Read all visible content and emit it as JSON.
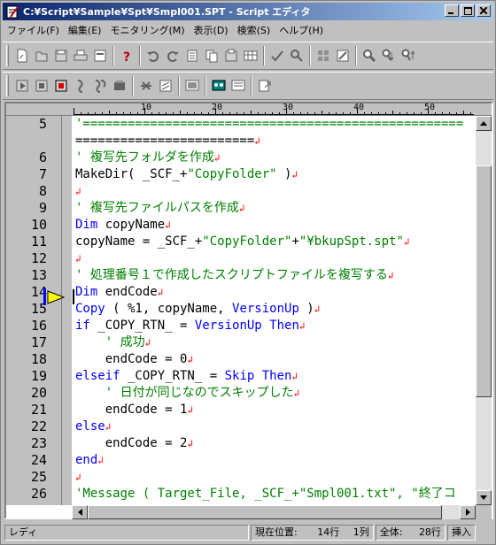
{
  "window": {
    "title": "C:¥Script¥Sample¥Spt¥Smpl001.SPT - Script エディタ"
  },
  "menu": [
    {
      "label": "ファイル(F)"
    },
    {
      "label": "編集(E)"
    },
    {
      "label": "モニタリング(M)"
    },
    {
      "label": "表示(D)"
    },
    {
      "label": "検索(S)"
    },
    {
      "label": "ヘルプ(H)"
    }
  ],
  "ruler": [
    "10",
    "20",
    "30",
    "40",
    "50"
  ],
  "editor": {
    "current_line": "14",
    "lines": [
      {
        "n": "5",
        "text": "'==================================================="
      },
      {
        "n": "",
        "text": "========================"
      },
      {
        "n": "6",
        "text": "' 複写先フォルダを作成"
      },
      {
        "n": "7",
        "text": "MakeDir( _SCF_+\"CopyFolder\" )"
      },
      {
        "n": "8",
        "text": ""
      },
      {
        "n": "9",
        "text": "' 複写先ファイルパスを作成"
      },
      {
        "n": "10",
        "text": "Dim copyName"
      },
      {
        "n": "11",
        "text": "copyName = _SCF_+\"CopyFolder\"+\"¥bkupSpt.spt\""
      },
      {
        "n": "12",
        "text": ""
      },
      {
        "n": "13",
        "text": "' 処理番号１で作成したスクリプトファイルを複写する"
      },
      {
        "n": "14",
        "text": "Dim endCode"
      },
      {
        "n": "15",
        "text": "Copy ( %1, copyName, VersionUp )"
      },
      {
        "n": "16",
        "text": "if _COPY_RTN_ = VersionUp Then"
      },
      {
        "n": "17",
        "text": "    ' 成功"
      },
      {
        "n": "18",
        "text": "    endCode = 0"
      },
      {
        "n": "19",
        "text": "elseif _COPY_RTN_ = Skip Then"
      },
      {
        "n": "20",
        "text": "    ' 日付が同じなのでスキップした"
      },
      {
        "n": "21",
        "text": "    endCode = 1"
      },
      {
        "n": "22",
        "text": "else"
      },
      {
        "n": "23",
        "text": "    endCode = 2"
      },
      {
        "n": "24",
        "text": "end"
      },
      {
        "n": "25",
        "text": ""
      },
      {
        "n": "26",
        "text": "'Message ( Target_File, _SCF_+\"Smpl001.txt\", \"終了コ"
      }
    ],
    "eol_mark": "↲"
  },
  "status": {
    "mode": "レディ",
    "position_label": "現在位置:",
    "position_line": "14行",
    "position_col": "1列",
    "total_label": "全体:",
    "total_lines": "28行",
    "insert": "挿入"
  },
  "icons": {
    "toolbar1": [
      "new-file-icon",
      "open-file-icon",
      "save-icon",
      "print-icon",
      "export-icon",
      "help-icon",
      "undo-icon",
      "redo-icon",
      "cut-icon",
      "copy-icon",
      "paste-icon",
      "table-icon",
      "check-icon",
      "search-replace-icon",
      "grid-icon",
      "edit-icon",
      "find-icon",
      "find-next-icon",
      "find-prev-icon"
    ],
    "toolbar2": [
      "run-icon",
      "stop-icon",
      "record-icon",
      "step-icon",
      "step-over-icon",
      "breakpoint-icon",
      "monitor-icon",
      "window-icon",
      "screen-icon",
      "capture-icon",
      "display-icon",
      "export-log-icon"
    ]
  }
}
